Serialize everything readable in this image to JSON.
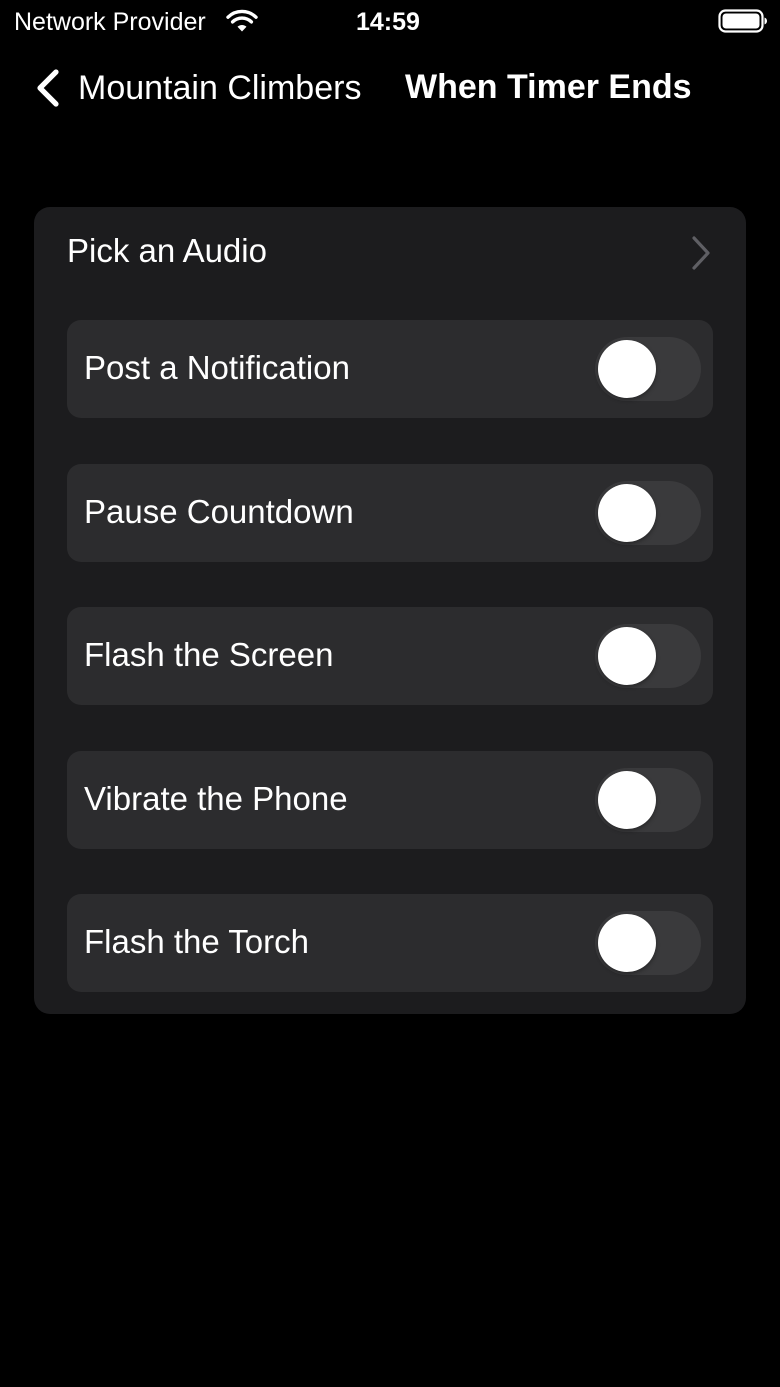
{
  "status_bar": {
    "carrier": "Network Provider",
    "time": "14:59",
    "wifi_icon": "wifi-icon",
    "battery_icon": "battery-icon"
  },
  "nav": {
    "back_label": "Mountain Climbers",
    "back_icon": "chevron-left-icon",
    "title": "When Timer Ends"
  },
  "audio": {
    "label": "Pick an Audio",
    "icon": "chevron-right-icon"
  },
  "options": [
    {
      "label": "Post a Notification",
      "enabled": false
    },
    {
      "label": "Pause Countdown",
      "enabled": false
    },
    {
      "label": "Flash the Screen",
      "enabled": false
    },
    {
      "label": "Vibrate the Phone",
      "enabled": false
    },
    {
      "label": "Flash the Torch",
      "enabled": false
    }
  ],
  "colors": {
    "background": "#000000",
    "card": "#1c1c1e",
    "row": "#2c2c2e",
    "toggle_off": "#3a3a3c",
    "toggle_on": "#34c759",
    "text": "#ffffff"
  }
}
